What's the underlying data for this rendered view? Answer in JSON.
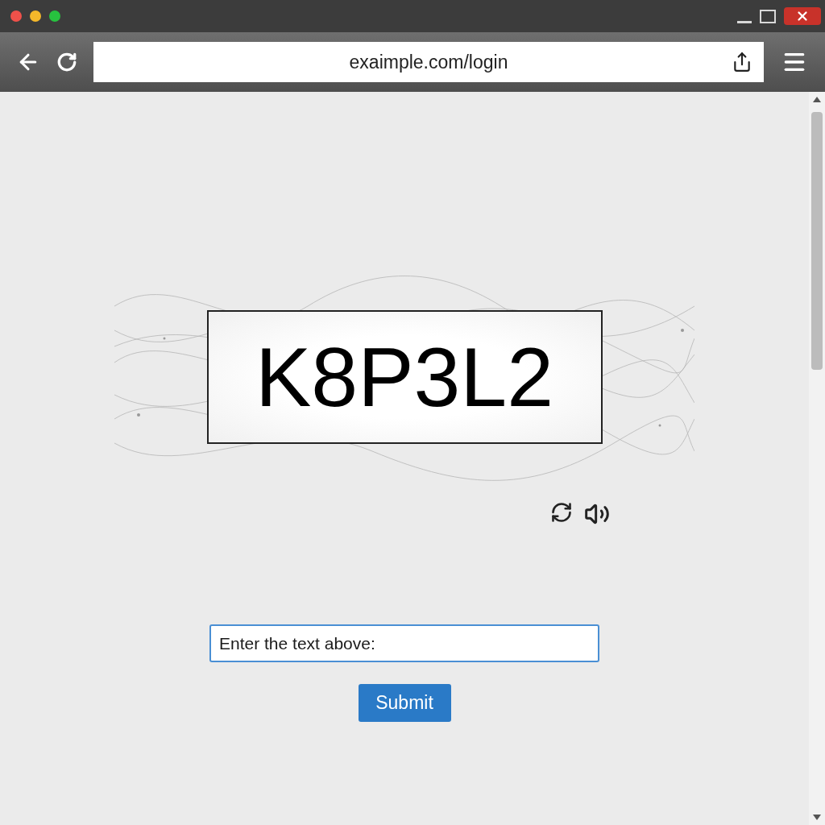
{
  "browser": {
    "url": "exaimple.com/login"
  },
  "captcha": {
    "code": "K8P3L2"
  },
  "form": {
    "placeholder": "Enter the text above:",
    "submit": "Submit"
  }
}
